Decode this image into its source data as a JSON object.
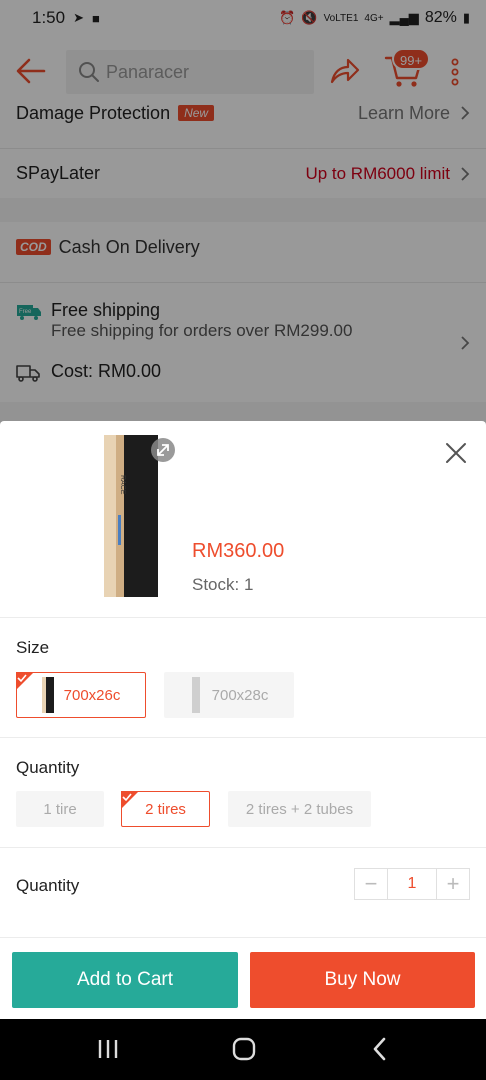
{
  "status_bar": {
    "time": "1:50",
    "battery": "82%",
    "network": "4G+",
    "volte": "VoLTE1"
  },
  "header": {
    "search_placeholder": "Panaracer",
    "cart_badge": "99+"
  },
  "rows": {
    "damage_protection": {
      "label": "Damage Protection",
      "tag": "New",
      "action": "Learn More"
    },
    "spaylater": {
      "label": "SPayLater",
      "value": "Up to RM6000 limit"
    },
    "cod": {
      "badge": "COD",
      "label": "Cash On Delivery"
    },
    "shipping": {
      "icon_text": "Free",
      "title": "Free shipping",
      "subtitle": "Free shipping for orders over RM299.00",
      "cost": "Cost: RM0.00"
    }
  },
  "sheet": {
    "price": "RM360.00",
    "stock": "Stock: 1",
    "size_section": {
      "title": "Size",
      "options": [
        {
          "label": "700x26c",
          "selected": true
        },
        {
          "label": "700x28c",
          "selected": false
        }
      ]
    },
    "variant_section": {
      "title": "Quantity",
      "options": [
        {
          "label": "1 tire",
          "selected": false
        },
        {
          "label": "2 tires",
          "selected": true
        },
        {
          "label": "2 tires + 2 tubes",
          "selected": false
        }
      ]
    },
    "quantity_section": {
      "title": "Quantity",
      "value": "1",
      "minus": "−",
      "plus": "+"
    },
    "buttons": {
      "add_to_cart": "Add to Cart",
      "buy_now": "Buy Now"
    }
  },
  "colors": {
    "brand": "#ee4d2d",
    "add_to_cart": "#26aa99",
    "spaylater_text": "#d0011b"
  }
}
